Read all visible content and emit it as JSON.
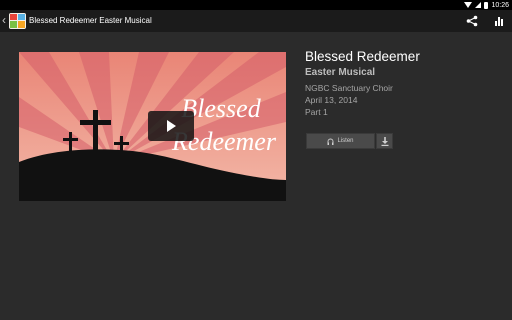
{
  "status_bar": {
    "time": "10:26"
  },
  "action_bar": {
    "title": "Blessed Redeemer Easter Musical",
    "icons": [
      "back-arrow-icon",
      "app-logo-icon",
      "share-icon",
      "bar-chart-icon"
    ]
  },
  "video": {
    "thumbnail_title_line1": "Blessed",
    "thumbnail_title_line2": "Redeemer",
    "play_icon": "play-icon",
    "colors": {
      "sky_top": "#e98576",
      "sky_bottom": "#f3b8a8",
      "ray": "#d65f6a",
      "hill": "#111111"
    }
  },
  "details": {
    "title": "Blessed Redeemer",
    "subtitle": "Easter Musical",
    "artist": "NGBC Sanctuary Choir",
    "date": "April 13, 2014",
    "part": "Part 1"
  },
  "actions": {
    "listen_label": "Listen",
    "listen_icon": "headphones-icon",
    "download_icon": "download-icon"
  }
}
